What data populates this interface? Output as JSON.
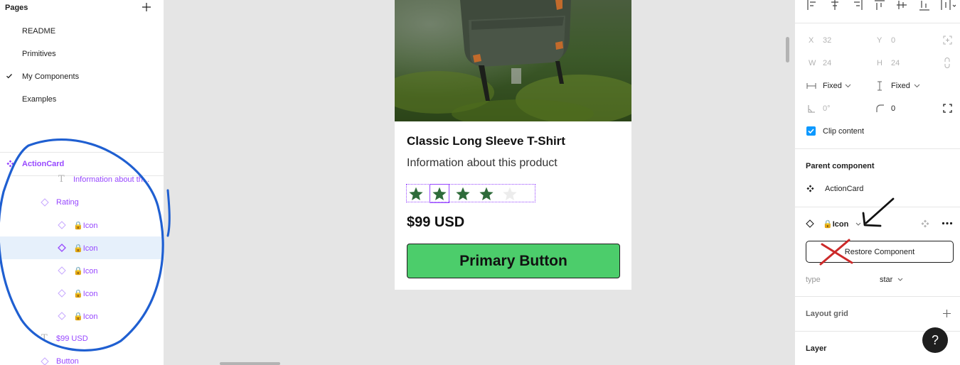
{
  "pages": {
    "title": "Pages",
    "items": [
      {
        "label": "README",
        "current": false
      },
      {
        "label": "Primitives",
        "current": false
      },
      {
        "label": "My Components",
        "current": true
      },
      {
        "label": "Examples",
        "current": false
      }
    ]
  },
  "layers": {
    "root": "ActionCard",
    "items": [
      {
        "label": "Information about th..."
      },
      {
        "label": "Rating"
      },
      {
        "label": "🔒Icon"
      },
      {
        "label": "🔒Icon"
      },
      {
        "label": "🔒Icon"
      },
      {
        "label": "🔒Icon"
      },
      {
        "label": "🔒Icon"
      },
      {
        "label": "$99 USD"
      },
      {
        "label": "Button"
      }
    ]
  },
  "card": {
    "title": "Classic Long Sleeve T-Shirt",
    "subtitle": "Information about this product",
    "price": "$99 USD",
    "button_label": "Primary Button",
    "rating": {
      "value": 4,
      "max": 5
    }
  },
  "properties": {
    "x_label": "X",
    "x_value": "32",
    "y_label": "Y",
    "y_value": "0",
    "w_label": "W",
    "w_value": "24",
    "h_label": "H",
    "h_value": "24",
    "width_mode": "Fixed",
    "height_mode": "Fixed",
    "rotation": "0°",
    "radius": "0",
    "clip_content": "Clip content",
    "parent_component_title": "Parent component",
    "parent_component_name": "ActionCard",
    "instance_name": "🔒Icon",
    "restore_label": "Restore Component",
    "type_label": "type",
    "type_value": "star",
    "layout_grid": "Layout grid",
    "layer": "Layer",
    "help": "?"
  },
  "colors": {
    "component_purple": "#9747ff",
    "selection_blue": "#0d99ff",
    "button_green": "#4ccd6b",
    "star_green": "#2e6b3a",
    "star_empty": "#ececec",
    "annotation_blue": "#1f5fd1",
    "annotation_red": "#cc2a2a"
  }
}
